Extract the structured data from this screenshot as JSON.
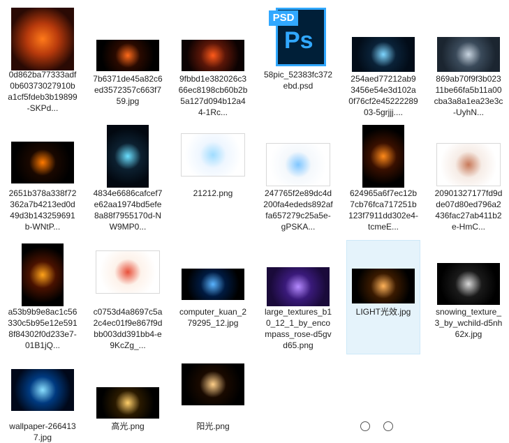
{
  "files": [
    {
      "name": "0d862ba77333adf0b60373027910ba1cf5fdeb3b19899-SKPd...",
      "type": "jpg",
      "thumb_colors": [
        "#2a0a04",
        "#b83a0c",
        "#ff7a1a"
      ]
    },
    {
      "name": "7b6371de45a82c6ed3572357c663f759.jpg",
      "type": "jpg",
      "thumb_colors": [
        "#000000",
        "#2a0a00",
        "#ff6a1a"
      ]
    },
    {
      "name": "9fbbd1e382026c366ec8198cb60b2b5a127d094b12a44-1Rc...",
      "type": "jpg",
      "thumb_colors": [
        "#0c0202",
        "#5a1608",
        "#ff5a1a"
      ]
    },
    {
      "name": "58pic_52383fc372ebd.psd",
      "type": "psd",
      "thumb_colors": [
        "#001f38",
        "#31a8ff",
        "#31a8ff"
      ]
    },
    {
      "name": "254aed77212ab93456e54e3d102a0f76cf2e4522228903-5grjjj....",
      "type": "jpg",
      "thumb_colors": [
        "#020c18",
        "#0a2238",
        "#7fd6ff"
      ]
    },
    {
      "name": "869ab70f9f3b02311be66fa5b11a00cba3a8a1ea23e3c-UyhN...",
      "type": "jpg",
      "thumb_colors": [
        "#1b2530",
        "#3a4a5a",
        "#c8d4e0"
      ]
    },
    {
      "name": "2651b378a338f72362a7b4213ed0d49d3b143259691b-WNtP...",
      "type": "jpg",
      "thumb_colors": [
        "#000000",
        "#1a0800",
        "#ff7a00"
      ]
    },
    {
      "name": "4834e6686cafcef7e62aa1974bd5efe8a88f7955170d-NW9MP0...",
      "type": "jpg",
      "thumb_colors": [
        "#020810",
        "#0c2030",
        "#6adfff"
      ]
    },
    {
      "name": "21212.png",
      "type": "png",
      "thumb_colors": [
        "#ffffff",
        "#eef6ff",
        "#9fdcff"
      ]
    },
    {
      "name": "247765f2e89dc4d200fa4ededs892affa657279c25a5e-gPSKA...",
      "type": "png",
      "thumb_colors": [
        "#ffffff",
        "#f4f8fc",
        "#7fc6ff"
      ]
    },
    {
      "name": "624965a6f7ec12b7cb76fca717251b123f7911dd302e4-tcmeE...",
      "type": "jpg",
      "thumb_colors": [
        "#000000",
        "#3a1000",
        "#ff8a1a"
      ]
    },
    {
      "name": "20901327177fd9dde07d80ed796a2436fac27ab411b2e-HmC...",
      "type": "png",
      "thumb_colors": [
        "#ffffff",
        "#f6ece6",
        "#c87a5a"
      ]
    },
    {
      "name": "a53b9b9e8ac1c56330c5b95e12e5918f84302f0d233e7-01B1jQ...",
      "type": "jpg",
      "thumb_colors": [
        "#000000",
        "#4a1200",
        "#ffa31a"
      ]
    },
    {
      "name": "c0753d4a8697c5a2c4ec01f9e867f9dbb003dd391bb4-e9KcZg_...",
      "type": "png",
      "thumb_colors": [
        "#ffffff",
        "#fdf2ea",
        "#e8503a"
      ]
    },
    {
      "name": "computer_kuan_279295_12.jpg",
      "type": "jpg",
      "thumb_colors": [
        "#000000",
        "#001a40",
        "#5ab4ff"
      ]
    },
    {
      "name": "large_textures_b10_12_1_by_encompass_rose-d5gvd65.png",
      "type": "png",
      "thumb_colors": [
        "#1a0a3a",
        "#3a1a7a",
        "#b58aff"
      ]
    },
    {
      "name": "LIGHT光效.jpg",
      "type": "jpg",
      "thumb_colors": [
        "#000000",
        "#3a1a00",
        "#ffb35a"
      ]
    },
    {
      "name": "snowing_texture_3_by_wchild-d5nh62x.jpg",
      "type": "jpg",
      "thumb_colors": [
        "#000000",
        "#1a1a1a",
        "#d8d8d8"
      ]
    },
    {
      "name": "wallpaper-2664137.jpg",
      "type": "jpg",
      "thumb_colors": [
        "#00081a",
        "#003a80",
        "#8adfff"
      ]
    },
    {
      "name": "高光.png",
      "type": "png",
      "thumb_colors": [
        "#000000",
        "#2a1a00",
        "#ffcf6a"
      ]
    },
    {
      "name": "阳光.png",
      "type": "png",
      "thumb_colors": [
        "#000000",
        "#1a0a00",
        "#ffd08a"
      ]
    }
  ],
  "selected_file": "LIGHT光效.jpg",
  "psd_badge": "PSD",
  "psd_logo": "Ps",
  "colors": {
    "selection_bg": "#e5f3fb",
    "selection_border": "#cde8f8",
    "psd_blue": "#31a8ff",
    "psd_dark": "#001f38"
  }
}
